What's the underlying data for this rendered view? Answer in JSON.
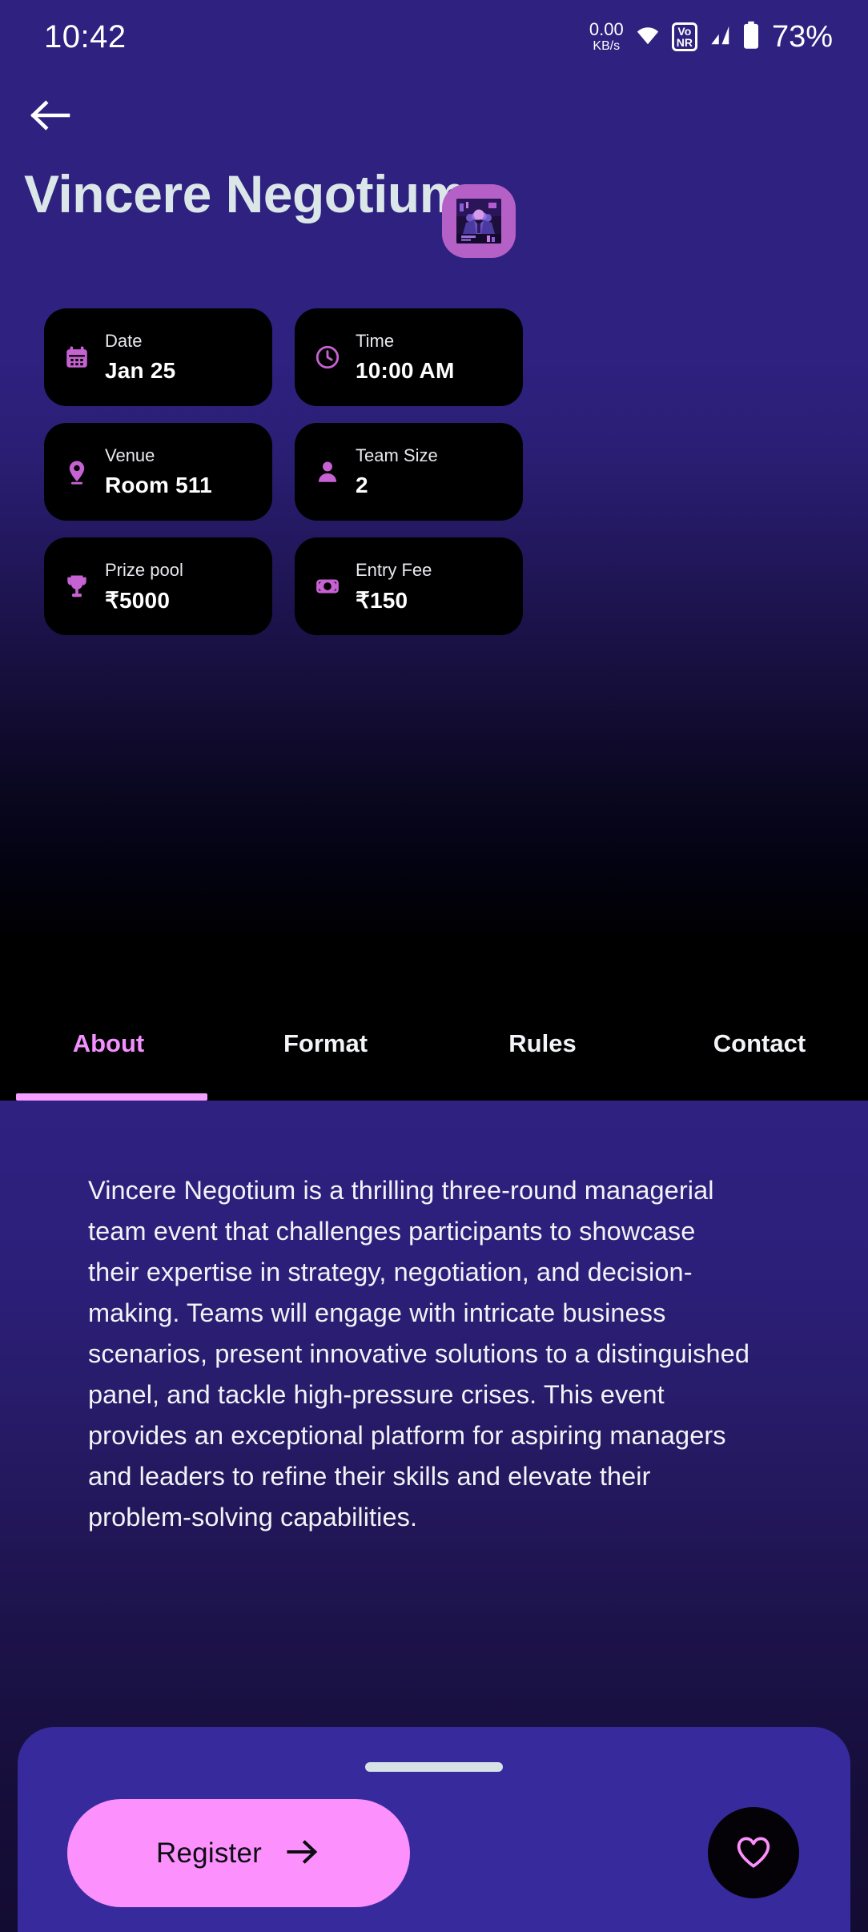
{
  "status_bar": {
    "time": "10:42",
    "net_speed_value": "0.00",
    "net_speed_unit": "KB/s",
    "wifi_icon": "wifi-icon",
    "vonr_top": "Vo",
    "vonr_bottom": "NR",
    "signal_icon": "cellular-signal-icon",
    "battery_icon": "battery-icon",
    "battery_percent": "73%"
  },
  "header": {
    "back_icon": "back-arrow-icon",
    "title": "Vincere Negotium",
    "thumbnail_alt": "event-poster-thumbnail"
  },
  "info_cards": [
    {
      "label": "Date",
      "value": "Jan 25",
      "icon": "calendar-icon"
    },
    {
      "label": "Time",
      "value": "10:00 AM",
      "icon": "clock-icon"
    },
    {
      "label": "Venue",
      "value": "Room 511",
      "icon": "location-pin-icon"
    },
    {
      "label": "Team Size",
      "value": "2",
      "icon": "person-icon"
    },
    {
      "label": "Prize pool",
      "value": "₹5000",
      "icon": "trophy-icon"
    },
    {
      "label": "Entry Fee",
      "value": "₹150",
      "icon": "banknote-icon"
    }
  ],
  "tabs": [
    {
      "label": "About",
      "active": true
    },
    {
      "label": "Format",
      "active": false
    },
    {
      "label": "Rules",
      "active": false
    },
    {
      "label": "Contact",
      "active": false
    }
  ],
  "content": {
    "description": "Vincere Negotium is a thrilling three-round managerial team event that challenges participants to showcase their expertise in strategy, negotiation, and decision-making. Teams will engage with intricate business scenarios, present innovative solutions to a distinguished panel, and tackle high-pressure crises. This event provides an exceptional platform for aspiring managers and leaders to refine their skills and elevate their problem-solving capabilities."
  },
  "bottom_bar": {
    "register_label": "Register",
    "register_arrow_icon": "arrow-right-icon",
    "favorite_icon": "heart-outline-icon"
  },
  "colors": {
    "brand_purple": "#2e2180",
    "sheet_purple": "#372a9c",
    "accent_pink": "#fc90fc",
    "tab_active_pink": "#f48fff",
    "icon_pink": "#c662d2",
    "card_black": "#000000",
    "title_text": "#dbe6e8"
  }
}
